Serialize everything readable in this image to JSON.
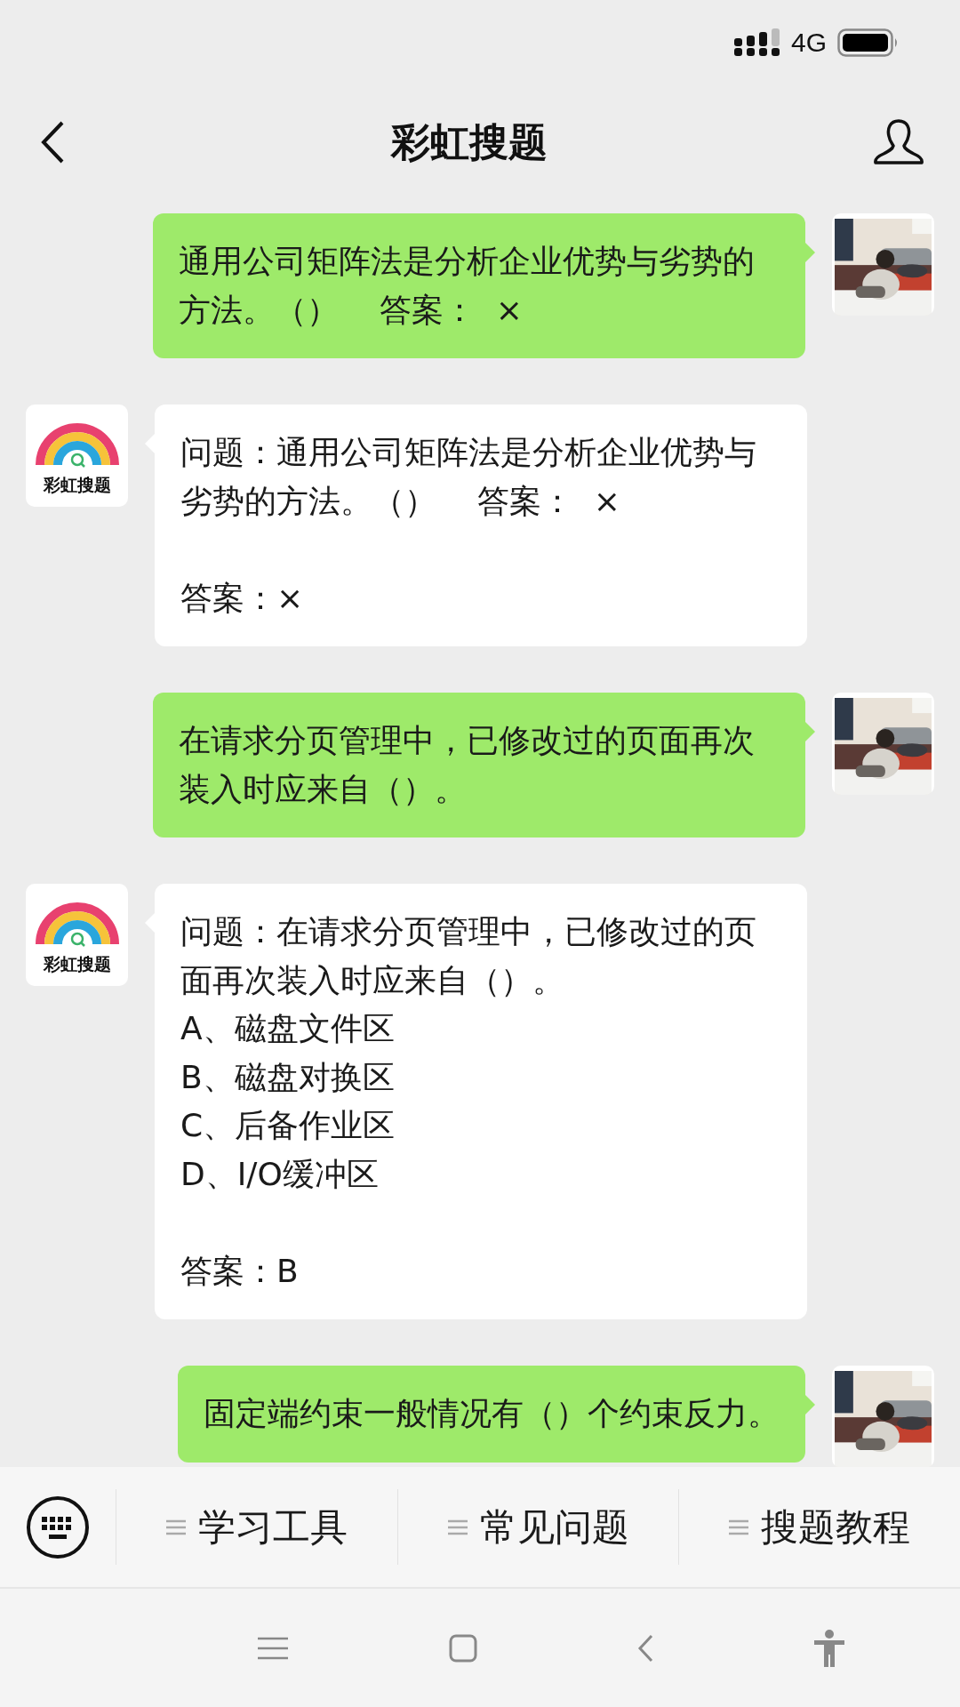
{
  "status_bar": {
    "network": "4G"
  },
  "header": {
    "title": "彩虹搜题"
  },
  "messages": [
    {
      "kind": "sent",
      "paragraphs": [
        {
          "lines": [
            "通用公司矩阵法是分析企业优势与劣势的方法。（）    答案：  ×"
          ]
        }
      ]
    },
    {
      "kind": "received",
      "avatar_label": "彩虹搜题",
      "paragraphs": [
        {
          "lines": [
            "问题：通用公司矩阵法是分析企业优势与劣势的方法。（）    答案：  ×"
          ]
        },
        {
          "lines": [
            "答案：×"
          ]
        }
      ]
    },
    {
      "kind": "sent",
      "paragraphs": [
        {
          "lines": [
            "在请求分页管理中，已修改过的页面再次装入时应来自（）。"
          ]
        }
      ]
    },
    {
      "kind": "received",
      "avatar_label": "彩虹搜题",
      "paragraphs": [
        {
          "lines": [
            "问题：在请求分页管理中，已修改过的页面再次装入时应来自（）。",
            "A、磁盘文件区",
            "B、磁盘对换区",
            "C、后备作业区",
            "D、I/O缓冲区"
          ]
        },
        {
          "lines": [
            "答案：B"
          ]
        }
      ]
    },
    {
      "kind": "sent",
      "paragraphs": [
        {
          "lines": [
            "固定端约束一般情况有（）个约束反力。"
          ]
        }
      ]
    }
  ],
  "menu": [
    {
      "label": "学习工具"
    },
    {
      "label": "常见问题"
    },
    {
      "label": "搜题教程"
    }
  ]
}
